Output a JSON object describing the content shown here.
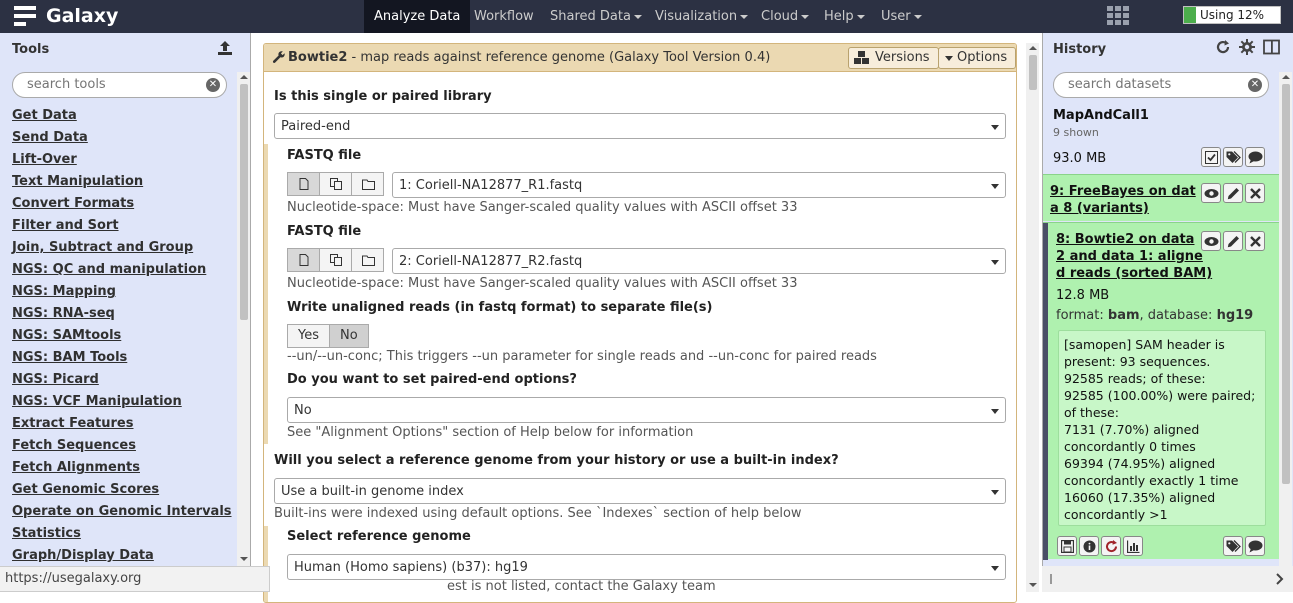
{
  "masthead": {
    "brand": "Galaxy",
    "nav": [
      {
        "label": "Analyze Data",
        "active": true,
        "caret": false
      },
      {
        "label": "Workflow",
        "active": false,
        "caret": false
      },
      {
        "label": "Shared Data",
        "active": false,
        "caret": true
      },
      {
        "label": "Visualization",
        "active": false,
        "caret": true
      },
      {
        "label": "Cloud",
        "active": false,
        "caret": true
      },
      {
        "label": "Help",
        "active": false,
        "caret": true
      },
      {
        "label": "User",
        "active": false,
        "caret": true
      }
    ],
    "quota_label": "Using 12%",
    "quota_percent": 12,
    "quota_color": "#4cae4c"
  },
  "tools": {
    "title": "Tools",
    "search_placeholder": "search tools",
    "items": [
      "Get Data",
      "Send Data",
      "Lift-Over",
      "Text Manipulation",
      "Convert Formats",
      "Filter and Sort",
      "Join, Subtract and Group",
      "NGS: QC and manipulation",
      "NGS: Mapping",
      "NGS: RNA-seq",
      "NGS: SAMtools",
      "NGS: BAM Tools",
      "NGS: Picard",
      "NGS: VCF Manipulation",
      "Extract Features",
      "Fetch Sequences",
      "Fetch Alignments",
      "Get Genomic Scores",
      "Operate on Genomic Intervals",
      "Statistics",
      "Graph/Display Data"
    ]
  },
  "tool_form": {
    "name": "Bowtie2",
    "description": " - map reads against reference genome (Galaxy Tool Version 0.4)",
    "versions_label": "Versions",
    "options_label": "Options",
    "library_label": "Is this single or paired library",
    "library_value": "Paired-end",
    "fastq1_label": "FASTQ file",
    "fastq1_value": "1: Coriell-NA12877_R1.fastq",
    "fastq1_help": "Nucleotide-space: Must have Sanger-scaled quality values with ASCII offset 33",
    "fastq2_label": "FASTQ file",
    "fastq2_value": "2: Coriell-NA12877_R2.fastq",
    "fastq2_help": "Nucleotide-space: Must have Sanger-scaled quality values with ASCII offset 33",
    "unaligned_label": "Write unaligned reads (in fastq format) to separate file(s)",
    "yes_label": "Yes",
    "no_label": "No",
    "unaligned_help": "--un/--un-conc; This triggers --un parameter for single reads and --un-conc for paired reads",
    "pe_options_label": "Do you want to set paired-end options?",
    "pe_options_value": "No",
    "pe_options_help": "See \"Alignment Options\" section of Help below for information",
    "ref_source_label": "Will you select a reference genome from your history or use a built-in index?",
    "ref_source_value": "Use a built-in genome index",
    "ref_source_help": "Built-ins were indexed using default options. See `Indexes` section of help below",
    "ref_genome_label": "Select reference genome",
    "ref_genome_value": "Human (Homo sapiens) (b37): hg19",
    "ref_genome_help": "est is not listed, contact the Galaxy team"
  },
  "history": {
    "title": "History",
    "search_placeholder": "search datasets",
    "name": "MapAndCall1",
    "shown": "9 shown",
    "size": "93.0 MB",
    "ds9_title_l1": "9: FreeBayes on dat",
    "ds9_title_l2": "a 8 (variants)",
    "ds8_title_l1": "8: Bowtie2 on data",
    "ds8_title_l2": "2 and data 1: aligne",
    "ds8_title_l3": "d reads (sorted BAM)",
    "ds8_size": "12.8 MB",
    "ds8_format_label": "format: ",
    "ds8_format": "bam",
    "ds8_db_label": ", database: ",
    "ds8_db": "hg19",
    "peek": [
      "[samopen] SAM header is",
      "present: 93 sequences.",
      "92585 reads; of these:",
      "92585 (100.00%) were paired;",
      "of these:",
      "7131 (7.70%) aligned",
      "concordantly 0 times",
      "69394 (74.95%) aligned",
      "concordantly exactly 1 time",
      "16060 (17.35%) aligned",
      "concordantly >1"
    ]
  },
  "status_url": "https://usegalaxy.org"
}
